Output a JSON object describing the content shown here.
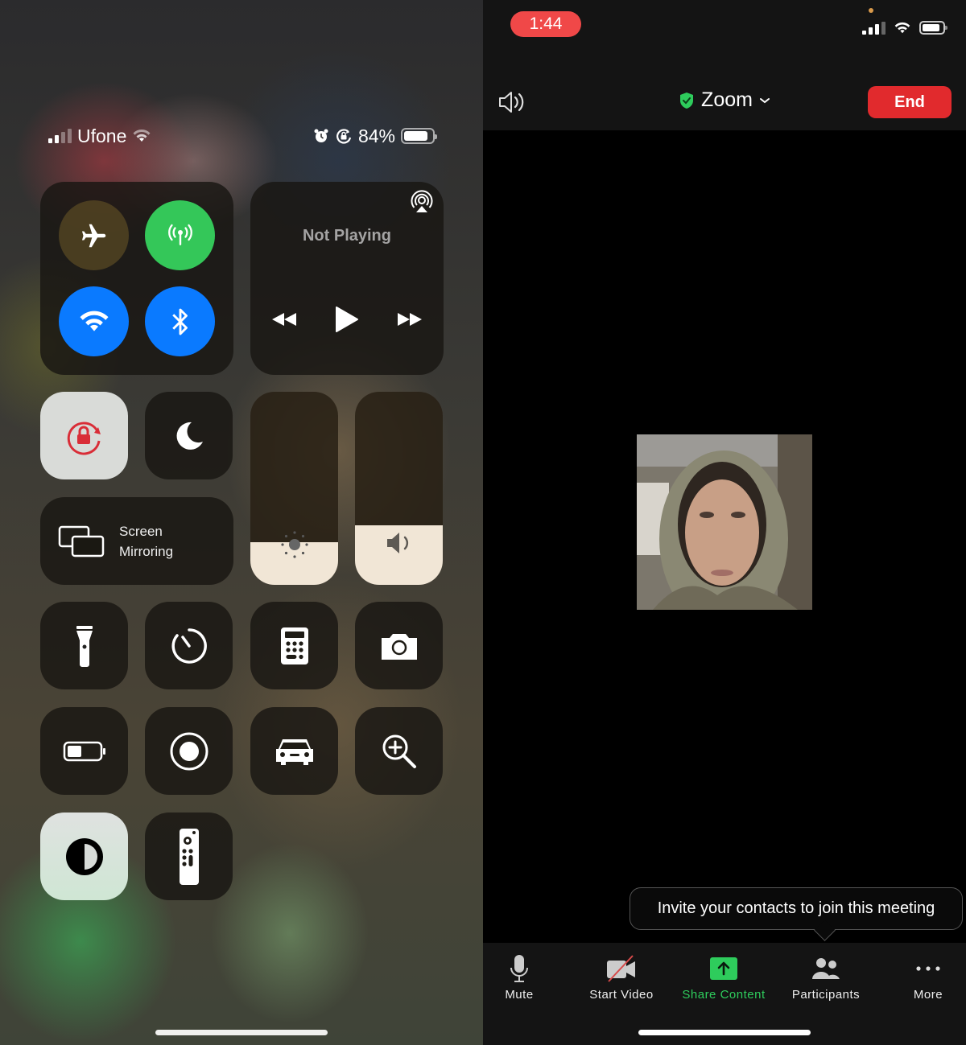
{
  "control_center": {
    "status_bar": {
      "carrier": "Ufone",
      "battery_percent": "84%",
      "icons": [
        "cellular-signal-icon",
        "wifi-icon",
        "alarm-icon",
        "rotation-lock-icon",
        "battery-icon"
      ]
    },
    "connectivity": {
      "airplane_mode": false,
      "cellular_data": true,
      "wifi": true,
      "bluetooth": true,
      "colors": {
        "cellular": "#34c759",
        "wifi": "#0a7aff",
        "bluetooth": "#0a7aff"
      }
    },
    "now_playing": {
      "status": "Not Playing",
      "controls": [
        "rewind",
        "play",
        "fast-forward"
      ]
    },
    "rotation_lock": {
      "enabled": true,
      "color": "#d92d37"
    },
    "do_not_disturb": {
      "enabled": false
    },
    "screen_mirroring": {
      "label_line1": "Screen",
      "label_line2": "Mirroring"
    },
    "brightness": {
      "level_percent": 22
    },
    "volume": {
      "level_percent": 31
    },
    "shortcuts_row1": [
      "flashlight",
      "timer",
      "calculator",
      "camera"
    ],
    "shortcuts_row2": [
      "low-power-mode",
      "screen-recording",
      "driving-focus",
      "magnifier"
    ],
    "shortcuts_row3": [
      "dark-mode",
      "apple-tv-remote"
    ]
  },
  "zoom": {
    "status_bar": {
      "time": "1:44",
      "time_pill_color": "#f04848"
    },
    "header": {
      "meeting_title": "Zoom",
      "end_label": "End",
      "secure_color": "#2ecc5c",
      "end_color": "#e12a2d"
    },
    "tooltip": "Invite your contacts to join this meeting",
    "toolbar": [
      {
        "id": "mute",
        "label": "Mute"
      },
      {
        "id": "start-video",
        "label": "Start Video"
      },
      {
        "id": "share-content",
        "label": "Share Content",
        "active": true
      },
      {
        "id": "participants",
        "label": "Participants"
      },
      {
        "id": "more",
        "label": "More"
      }
    ]
  }
}
